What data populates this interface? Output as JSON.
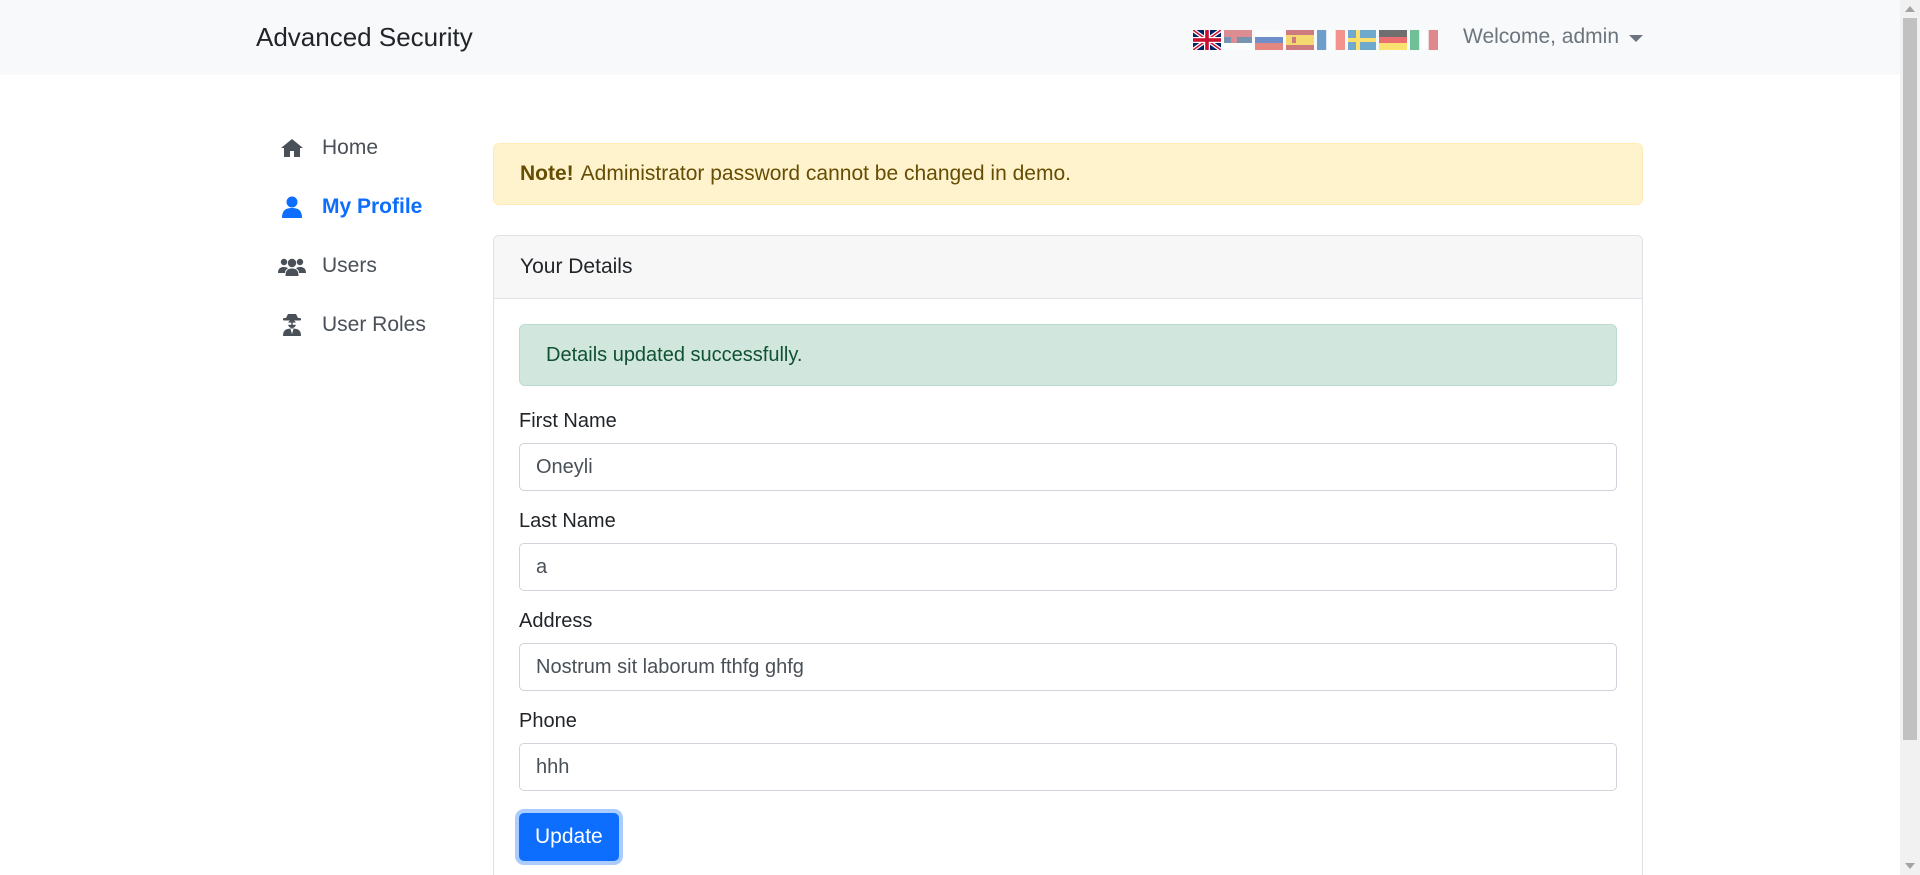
{
  "navbar": {
    "brand": "Advanced Security",
    "flags": [
      {
        "icon": "flag-uk-icon",
        "active": true
      },
      {
        "icon": "flag-serbia-icon",
        "active": false
      },
      {
        "icon": "flag-russia-icon",
        "active": false
      },
      {
        "icon": "flag-spain-icon",
        "active": false
      },
      {
        "icon": "flag-france-icon",
        "active": false
      },
      {
        "icon": "flag-sweden-icon",
        "active": false
      },
      {
        "icon": "flag-germany-icon",
        "active": false
      },
      {
        "icon": "flag-italy-icon",
        "active": false
      }
    ],
    "welcome": "Welcome, admin"
  },
  "sidebar": {
    "items": [
      {
        "label": "Home",
        "icon": "home-icon",
        "active": false
      },
      {
        "label": "My Profile",
        "icon": "user-icon",
        "active": true
      },
      {
        "label": "Users",
        "icon": "users-icon",
        "active": false
      },
      {
        "label": "User Roles",
        "icon": "user-secret-icon",
        "active": false
      }
    ]
  },
  "notice": {
    "strong": "Note!",
    "text": "Administrator password cannot be changed in demo."
  },
  "card": {
    "title": "Your Details",
    "success": "Details updated successfully.",
    "fields": [
      {
        "label": "First Name",
        "value": "Oneyli"
      },
      {
        "label": "Last Name",
        "value": "a"
      },
      {
        "label": "Address",
        "value": "Nostrum sit laborum fthfg ghfg"
      },
      {
        "label": "Phone",
        "value": "hhh"
      }
    ],
    "submit": "Update"
  },
  "colors": {
    "accent": "#0d6efd",
    "warning_bg": "#fff3cd",
    "success_bg": "#d1e7dd"
  }
}
